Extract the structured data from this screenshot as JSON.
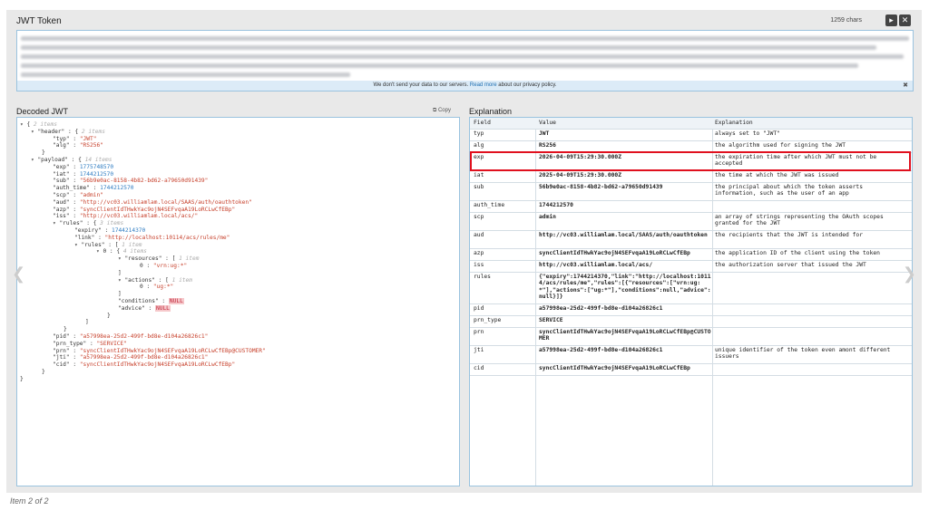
{
  "token": {
    "title": "JWT Token",
    "chars": "1259 chars",
    "notice_pre": "We don't send your data to our servers.",
    "notice_link": "Read more",
    "notice_post": "about our privacy policy."
  },
  "decoded": {
    "title": "Decoded JWT",
    "copy_label": "Copy",
    "lines": [
      {
        "i": 0,
        "t": "{ ",
        "c": "2 items"
      },
      {
        "i": 1,
        "k": "header",
        "t": ": { ",
        "c": "2 items"
      },
      {
        "i": 3,
        "k": "typ",
        "s": "JWT"
      },
      {
        "i": 3,
        "k": "alg",
        "s": "RS256"
      },
      {
        "i": 2,
        "t": "}"
      },
      {
        "i": 1,
        "k": "payload",
        "t": ": { ",
        "c": "14 items"
      },
      {
        "i": 3,
        "k": "exp",
        "n": "1775748570"
      },
      {
        "i": 3,
        "k": "iat",
        "n": "1744212570"
      },
      {
        "i": 3,
        "k": "sub",
        "s": "56b9e0ac-8158-4b82-bd62-a79650d91439"
      },
      {
        "i": 3,
        "k": "auth_time",
        "n": "1744212570"
      },
      {
        "i": 3,
        "k": "scp",
        "s": "admin"
      },
      {
        "i": 3,
        "k": "aud",
        "s": "http://vc03.williamlam.local/SAAS/auth/oauthtoken"
      },
      {
        "i": 3,
        "k": "azp",
        "s": "syncClientIdTHwkYac9ojN4SEFvqaA19LoRCLwCfEBp"
      },
      {
        "i": 3,
        "k": "iss",
        "s": "http://vc03.williamlam.local/acs/"
      },
      {
        "i": 3,
        "k": "rules",
        "t": ": { ",
        "c": "3 items"
      },
      {
        "i": 5,
        "k": "expiry",
        "n": "1744214370"
      },
      {
        "i": 5,
        "k": "link",
        "s": "http://localhost:10114/acs/rules/me"
      },
      {
        "i": 5,
        "k": "rules",
        "t": ": [ ",
        "c": "1 item"
      },
      {
        "i": 7,
        "k0": "0",
        "t": ": { ",
        "c": "4 items"
      },
      {
        "i": 9,
        "k": "resources",
        "t": ": [ ",
        "c": "1 item"
      },
      {
        "i": 11,
        "k0": "0",
        "s": "vrn:ug:*"
      },
      {
        "i": 9,
        "t": "]"
      },
      {
        "i": 9,
        "k": "actions",
        "t": ": [ ",
        "c": "1 item"
      },
      {
        "i": 11,
        "k0": "0",
        "s": "ug:*"
      },
      {
        "i": 9,
        "t": "]"
      },
      {
        "i": 9,
        "k": "conditions",
        "z": "NULL"
      },
      {
        "i": 9,
        "k": "advice",
        "z": "NULL"
      },
      {
        "i": 8,
        "t": "}"
      },
      {
        "i": 6,
        "t": "]"
      },
      {
        "i": 4,
        "t": "}"
      },
      {
        "i": 3,
        "k": "pid",
        "s": "a57998ea-25d2-499f-bd8e-d104a26826c1"
      },
      {
        "i": 3,
        "k": "prn_type",
        "s": "SERVICE"
      },
      {
        "i": 3,
        "k": "prn",
        "s": "syncClientIdTHwkYac9ojN4SEFvqaA19LoRCLwCfEBp@CUSTOMER"
      },
      {
        "i": 3,
        "k": "jti",
        "s": "a57998ea-25d2-499f-bd8e-d104a26826c1"
      },
      {
        "i": 3,
        "k": "cid",
        "s": "syncClientIdTHwkYac9ojN4SEFvqaA19LoRCLwCfEBp"
      },
      {
        "i": 2,
        "t": "}"
      },
      {
        "i": 0,
        "t": "}"
      }
    ]
  },
  "explanation": {
    "title": "Explanation",
    "headers": [
      "Field",
      "Value",
      "Explanation"
    ],
    "rows": [
      {
        "f": "typ",
        "v": "JWT",
        "e": "always set to \"JWT\"",
        "h": 13
      },
      {
        "f": "alg",
        "v": "RS256",
        "e": "the algorithm used for signing the JWT",
        "h": 13
      },
      {
        "f": "exp",
        "v": "2026-04-09T15:29:30.000Z",
        "e": "the expiration time after which JWT must not be accepted",
        "h": 20
      },
      {
        "f": "iat",
        "v": "2025-04-09T15:29:30.000Z",
        "e": "the time at which the JWT was issued",
        "h": 13
      },
      {
        "f": "sub",
        "v": "56b9e0ac-8158-4b82-bd62-a79650d91439",
        "e": "the principal about which the token asserts information, such as the user of an app",
        "h": 20
      },
      {
        "f": "auth_time",
        "v": "1744212570",
        "e": "",
        "h": 13
      },
      {
        "f": "scp",
        "v": "admin",
        "e": "an array of strings representing the OAuth scopes granted for the JWT",
        "h": 20
      },
      {
        "f": "aud",
        "v": "http://vc03.williamlam.local/SAAS/auth/oauthtoken",
        "e": "the recipients that the JWT is intended for",
        "h": 20
      },
      {
        "f": "azp",
        "v": "syncClientIdTHwkYac9ojN4SEFvqaA19LoRCLwCfEBp",
        "e": "the application ID of the client using the token",
        "h": 13
      },
      {
        "f": "iss",
        "v": "http://vc03.williamlam.local/acs/",
        "e": "the authorization server that issued the JWT",
        "h": 13
      },
      {
        "f": "rules",
        "v": "{\"expiry\":1744214370,\"link\":\"http://localhost:10114/acs/rules/me\",\"rules\":[{\"resources\":[\"vrn:ug:*\"],\"actions\":[\"ug:*\"],\"conditions\":null,\"advice\":null}]}",
        "e": "",
        "h": 35
      },
      {
        "f": "pid",
        "v": "a57998ea-25d2-499f-bd8e-d104a26826c1",
        "e": "",
        "h": 13
      },
      {
        "f": "prn_type",
        "v": "SERVICE",
        "e": "",
        "h": 13
      },
      {
        "f": "prn",
        "v": "syncClientIdTHwkYac9ojN4SEFvqaA19LoRCLwCfEBp@CUSTOMER",
        "e": "",
        "h": 20
      },
      {
        "f": "jti",
        "v": "a57998ea-25d2-499f-bd8e-d104a26826c1",
        "e": "unique identifier of the token even amont different issuers",
        "h": 20
      },
      {
        "f": "cid",
        "v": "syncClientIdTHwkYac9ojN4SEFvqaA19LoRCLwCfEBp",
        "e": "",
        "h": 13
      }
    ]
  },
  "caption": "Item 2 of 2"
}
